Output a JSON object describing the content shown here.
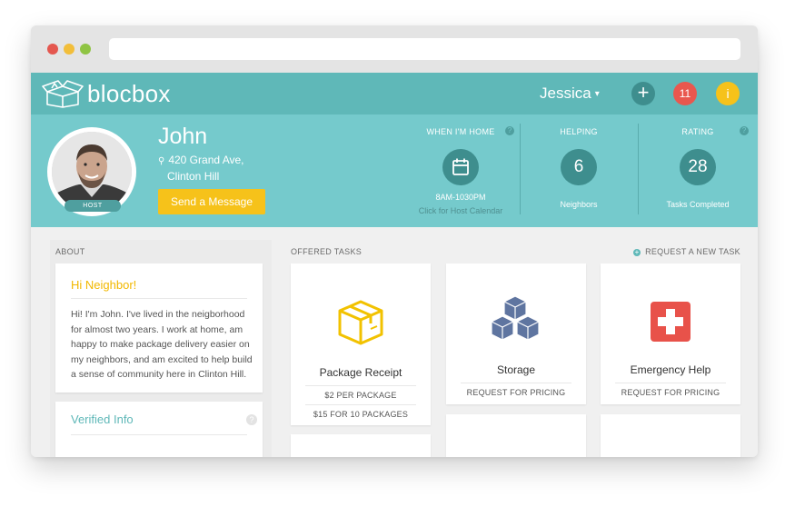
{
  "app": {
    "name_bold": "bloc",
    "name_light": "box"
  },
  "topnav": {
    "user_name": "Jessica",
    "user_caret": "▾",
    "add_label": "+",
    "notifications_count": "11",
    "info_label": "i"
  },
  "profile": {
    "name": "John",
    "address_line1": "420 Grand Ave,",
    "address_line2": "Clinton Hill",
    "role_badge": "HOST",
    "send_message": "Send a Message"
  },
  "stats": {
    "home": {
      "title": "WHEN I'M HOME",
      "hours": "8AM-1030PM",
      "link": "Click for Host Calendar",
      "help": "?"
    },
    "helping": {
      "title": "HELPING",
      "value": "6",
      "sub": "Neighbors"
    },
    "rating": {
      "title": "RATING",
      "value": "28",
      "sub": "Tasks Completed",
      "help": "?"
    }
  },
  "about": {
    "section_label": "ABOUT",
    "greeting": "Hi Neighbor!",
    "bio": "Hi! I'm John. I've lived in the neigborhood for almost two years. I work at home, am happy to make package delivery easier on my neighbors, and am excited to help build a sense of community here in Clinton Hill.",
    "verified_title": "Verified Info",
    "verified_help": "?"
  },
  "tasks": {
    "section_label": "OFFERED TASKS",
    "request_new": "REQUEST A NEW TASK",
    "items": [
      {
        "name": "Package Receipt",
        "prices": [
          "$2 PER PACKAGE",
          "$15 FOR 10 PACKAGES"
        ],
        "icon": "package-icon"
      },
      {
        "name": "Storage",
        "prices": [
          "REQUEST FOR PRICING"
        ],
        "icon": "storage-boxes-icon"
      },
      {
        "name": "Emergency Help",
        "prices": [
          "REQUEST FOR PRICING"
        ],
        "icon": "first-aid-icon"
      }
    ]
  },
  "colors": {
    "teal_dark": "#5fb8b8",
    "teal_light": "#75cacc",
    "teal_deep": "#3e8e8e",
    "yellow": "#f6c21a",
    "red": "#e9574e",
    "slate_blue": "#5f75a0"
  }
}
